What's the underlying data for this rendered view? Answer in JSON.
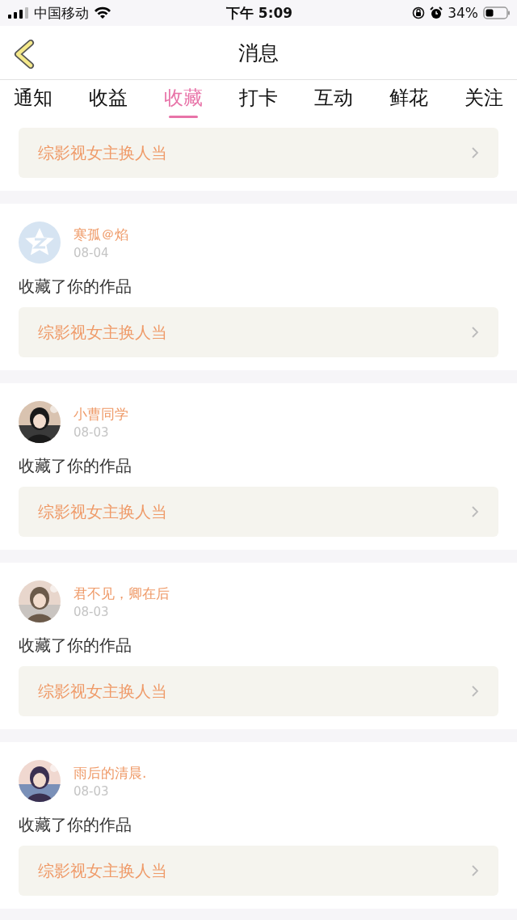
{
  "status_bar": {
    "carrier": "中国移动",
    "time": "下午 5:09",
    "battery": "34%"
  },
  "header": {
    "title": "消息"
  },
  "tabs": [
    {
      "label": "通知",
      "selected": false
    },
    {
      "label": "收益",
      "selected": false
    },
    {
      "label": "收藏",
      "selected": true
    },
    {
      "label": "打卡",
      "selected": false
    },
    {
      "label": "互动",
      "selected": false
    },
    {
      "label": "鲜花",
      "selected": false
    },
    {
      "label": "关注",
      "selected": false
    }
  ],
  "messages": [
    {
      "work": "综影视女主换人当"
    },
    {
      "avatar": {
        "kind": "default"
      },
      "user": "寒孤＠焰",
      "date": "08-04",
      "action": "收藏了你的作品",
      "work": "综影视女主换人当"
    },
    {
      "user": "小曹同学",
      "date": "08-03",
      "action": "收藏了你的作品",
      "work": "综影视女主换人当"
    },
    {
      "user": "君不见，卿在后",
      "date": "08-03",
      "action": "收藏了你的作品",
      "work": "综影视女主换人当"
    },
    {
      "user": "雨后的清晨.",
      "date": "08-03",
      "action": "收藏了你的作品",
      "work": "综影视女主换人当"
    }
  ]
}
